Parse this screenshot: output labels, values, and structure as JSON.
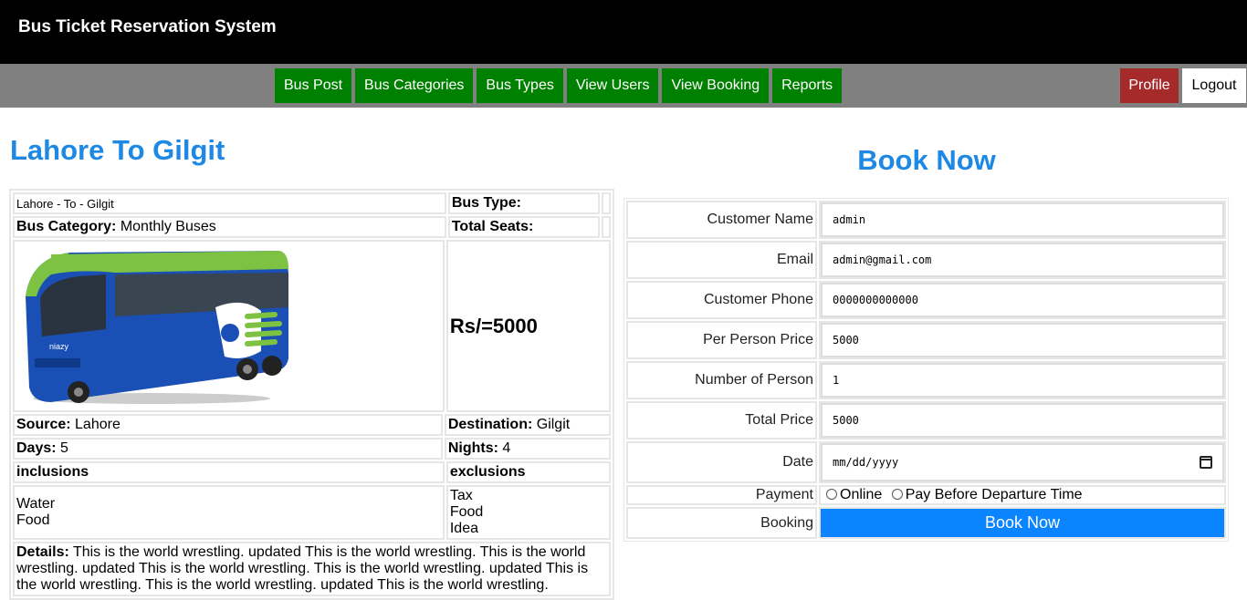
{
  "app": {
    "title": "Bus Ticket Reservation System"
  },
  "nav": {
    "items": [
      {
        "label": "Bus Post"
      },
      {
        "label": "Bus Categories"
      },
      {
        "label": "Bus Types"
      },
      {
        "label": "View Users"
      },
      {
        "label": "View Booking"
      },
      {
        "label": "Reports"
      }
    ],
    "profile": "Profile",
    "logout": "Logout"
  },
  "route": {
    "title": "Lahore To Gilgit",
    "subtitle": "Lahore - To - Gilgit",
    "bus_type_label": "Bus Type:",
    "bus_type_value": "",
    "category_label": "Bus Category:",
    "category_value": "Monthly Buses",
    "seats_label": "Total Seats:",
    "seats_value": "",
    "price": "Rs/=5000",
    "source_label": "Source:",
    "source_value": "Lahore",
    "destination_label": "Destination:",
    "destination_value": "Gilgit",
    "days_label": "Days:",
    "days_value": "5",
    "nights_label": "Nights:",
    "nights_value": "4",
    "inclusions_label": "inclusions",
    "exclusions_label": "exclusions",
    "inclusions": [
      "Water",
      "Food"
    ],
    "exclusions": [
      "Tax",
      "Food",
      "Idea"
    ],
    "details_label": "Details:",
    "details_text": "This is the world wrestling. updated This is the world wrestling. This is the world wrestling. updated This is the world wrestling. This is the world wrestling. updated This is the world wrestling. This is the world wrestling. updated This is the world wrestling.",
    "bus_logo_text": "niazy"
  },
  "booking": {
    "title": "Book Now",
    "fields": [
      {
        "label": "Customer Name",
        "value": "admin"
      },
      {
        "label": "Email",
        "value": "admin@gmail.com"
      },
      {
        "label": "Customer Phone",
        "value": "0000000000000"
      },
      {
        "label": "Per Person Price",
        "value": "5000"
      },
      {
        "label": "Number of Person",
        "value": "1"
      },
      {
        "label": "Total Price",
        "value": "5000"
      }
    ],
    "date_label": "Date",
    "date_placeholder": "mm/dd/yyyy",
    "payment_label": "Payment",
    "payment_options": [
      "Online",
      "Pay Before Departure Time"
    ],
    "booking_label": "Booking",
    "submit": "Book Now"
  },
  "colors": {
    "header_bg": "#000000",
    "nav_bg": "#808080",
    "nav_button": "#008000",
    "profile_button": "#a52a2a",
    "title_blue": "#1e88e5",
    "submit_blue": "#0a84ff"
  }
}
